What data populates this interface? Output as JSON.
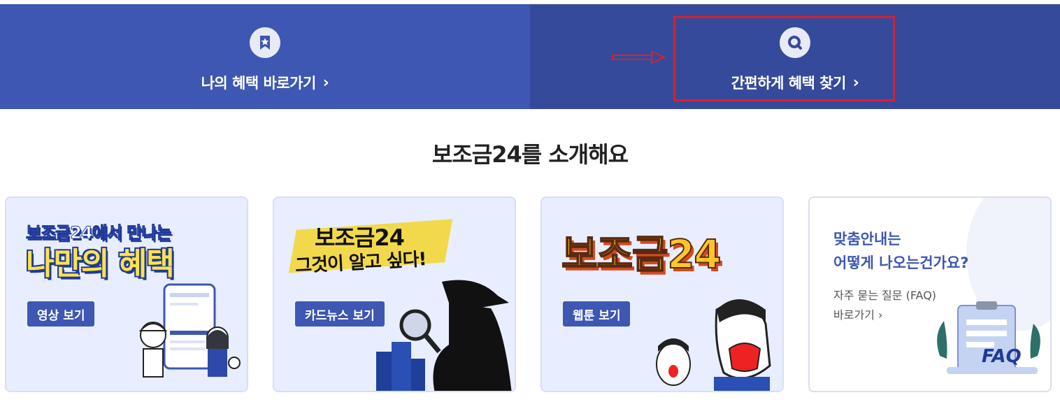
{
  "banner": {
    "left": {
      "label": "나의 혜택 바로가기",
      "icon": "star-bookmark-icon",
      "color": "#3d57b2"
    },
    "right": {
      "label": "간편하게 혜택 찾기",
      "icon": "search-icon",
      "color": "#364a9b"
    },
    "chevron": "›"
  },
  "section": {
    "title": "보조금24를 소개해요"
  },
  "cards": [
    {
      "headline1": "보조금24에서 만나는",
      "headline2": "나만의 혜택",
      "button": "영상 보기"
    },
    {
      "headline1": "보조금24",
      "headline2": "그것이 알고 싶다!",
      "button": "카드뉴스 보기"
    },
    {
      "headline1": "보조금24",
      "button": "웹툰 보기"
    },
    {
      "line1": "맞춤안내는",
      "line2": "어떻게 나오는건가요?",
      "sub1": "자주 묻는 질문 (FAQ)",
      "sub2": "바로가기 ›",
      "badge": "FAQ"
    }
  ],
  "annotation": {
    "highlight_color": "#d7222d"
  }
}
